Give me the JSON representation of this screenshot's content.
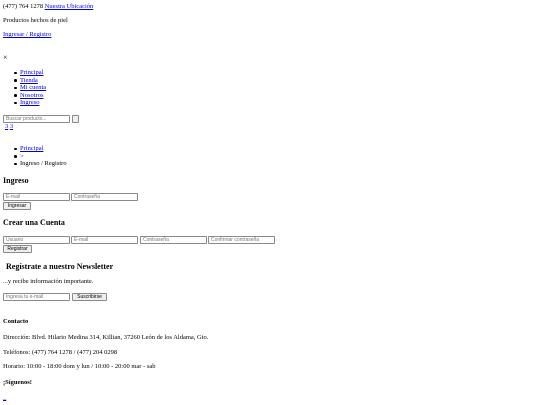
{
  "topbar": {
    "phone": "(477) 764 1278",
    "location_link": "Nuestra Ubicación"
  },
  "brand": {
    "tagline": "Productos hechos de piel"
  },
  "account": {
    "login_register_link": "Ingresar / Registro"
  },
  "menu": {
    "close_glyph": "×",
    "items": [
      {
        "label": "Principal"
      },
      {
        "label": "Tienda"
      },
      {
        "label": "Mi cuenta"
      },
      {
        "label": "Nosotros"
      },
      {
        "label": "Ingreso"
      }
    ]
  },
  "search": {
    "placeholder": "Buscar producto..."
  },
  "cart": {
    "count_a": "3",
    "count_b": "3"
  },
  "breadcrumb": {
    "home": "Principal",
    "separator": ">",
    "current": "Ingreso / Registro"
  },
  "login": {
    "title": "Ingreso",
    "email_placeholder": "E-mail",
    "password_placeholder": "Contraseña",
    "submit_label": "Ingresar"
  },
  "register": {
    "title": "Crear una Cuenta",
    "user_placeholder": "Usuario",
    "email_placeholder": "E-mail",
    "password_placeholder": "Contraseña",
    "confirm_placeholder": "Confirmar contraseña",
    "submit_label": "Registrar"
  },
  "newsletter": {
    "title": "Regístrate a nuestro Newsletter",
    "subtitle": "...y recibe información importante.",
    "email_placeholder": "Ingresa tu e-mail",
    "submit_label": "Suscribirse"
  },
  "contact": {
    "title": "Contacto",
    "address": "Dirección: Blvd. Hilario Medina 314, Killian, 37260 León de los Aldama, Gto.",
    "phones": "Teléfonos: (477) 764 1278 / (477) 204 0298",
    "hours": "Horario: 10:00 - 18:00 dom y lun / 10:00 - 20:00 mar - sab"
  },
  "social": {
    "title": "¡Síguenos!",
    "link_text": "_"
  }
}
